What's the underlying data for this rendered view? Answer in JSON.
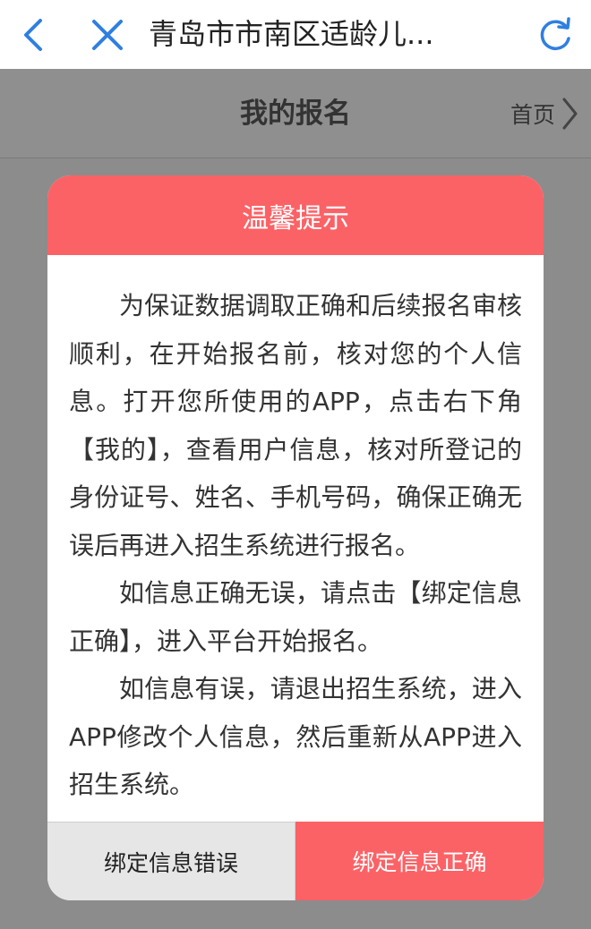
{
  "browser": {
    "title": "青岛市市南区适龄儿...",
    "accent": "#2f7fe0"
  },
  "header": {
    "title": "我的报名",
    "home_label": "首页"
  },
  "modal": {
    "title": "温馨提示",
    "paragraphs": [
      "为保证数据调取正确和后续报名审核顺利，在开始报名前，核对您的个人信息。打开您所使用的APP，点击右下角【我的】，查看用户信息，核对所登记的身份证号、姓名、手机号码，确保正确无误后再进入招生系统进行报名。",
      "如信息正确无误，请点击【绑定信息正确】，进入平台开始报名。",
      "如信息有误，请退出招生系统，进入APP修改个人信息，然后重新从APP进入招生系统。"
    ],
    "btn_wrong": "绑定信息错误",
    "btn_correct": "绑定信息正确",
    "accent": "#fb6266"
  },
  "icons": {
    "back": "chevron-left-icon",
    "close": "close-icon",
    "refresh": "refresh-icon",
    "home_arrow": "chevron-right-icon"
  }
}
